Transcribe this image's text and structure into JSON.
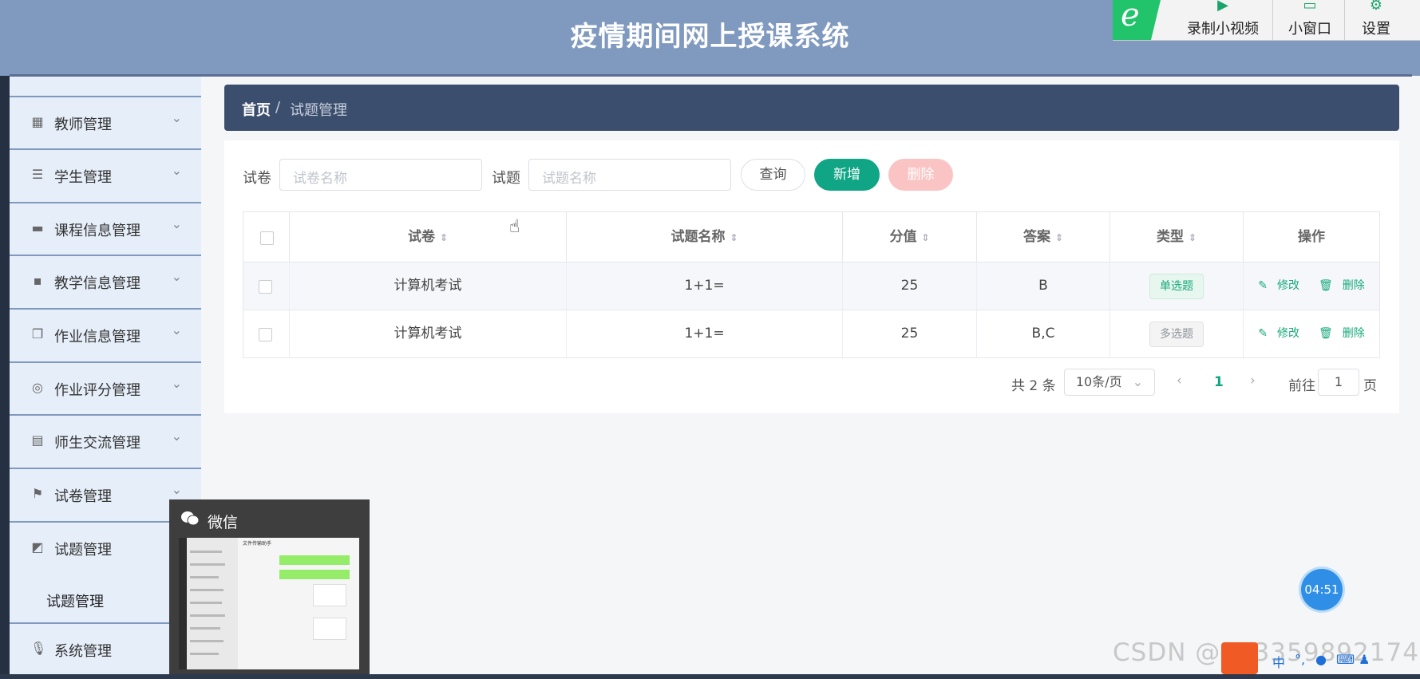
{
  "header": {
    "title": "疫情期间网上授课系统"
  },
  "toolbar": {
    "record_label": "录制小视频",
    "window_label": "小窗口",
    "settings_label": "设置"
  },
  "sidebar": {
    "items": [
      {
        "label": "教师管理",
        "icon": "grid-icon"
      },
      {
        "label": "学生管理",
        "icon": "sliders-icon"
      },
      {
        "label": "课程信息管理",
        "icon": "chalkboard-icon"
      },
      {
        "label": "教学信息管理",
        "icon": "message-icon"
      },
      {
        "label": "作业信息管理",
        "icon": "copy-icon"
      },
      {
        "label": "作业评分管理",
        "icon": "target-icon"
      },
      {
        "label": "师生交流管理",
        "icon": "clipboard-icon"
      },
      {
        "label": "试卷管理",
        "icon": "flag-icon"
      },
      {
        "label": "试题管理",
        "icon": "chart-icon"
      },
      {
        "label": "系统管理",
        "icon": "mic-icon"
      }
    ],
    "sub_active": "试题管理"
  },
  "breadcrumb": {
    "home": "首页",
    "separator": "/",
    "current": "试题管理"
  },
  "filters": {
    "paper_label": "试卷",
    "paper_placeholder": "试卷名称",
    "question_label": "试题",
    "question_placeholder": "试题名称",
    "query_button": "查询",
    "add_button": "新增",
    "delete_button": "删除"
  },
  "table": {
    "headers": [
      "试卷",
      "试题名称",
      "分值",
      "答案",
      "类型",
      "操作"
    ],
    "rows": [
      {
        "paper": "计算机考试",
        "question": "1+1=",
        "score": "25",
        "answer": "B",
        "type": "单选题"
      },
      {
        "paper": "计算机考试",
        "question": "1+1=",
        "score": "25",
        "answer": "B,C",
        "type": "多选题"
      }
    ],
    "edit_label": "修改",
    "delete_label": "删除"
  },
  "pagination": {
    "total": "共 2 条",
    "page_size": "10条/页",
    "current_page": "1",
    "goto_label": "前往",
    "goto_value": "1",
    "page_suffix": "页"
  },
  "wechat": {
    "title": "微信",
    "thumb_header": "文件传输助手"
  },
  "timer": "04:51",
  "watermark": "CSDN @053359892174",
  "colors": {
    "header": "#7f99bf",
    "breadcrumb": "#3c4e6d",
    "primary": "#0fa585",
    "danger_light": "#fbc4c4"
  }
}
